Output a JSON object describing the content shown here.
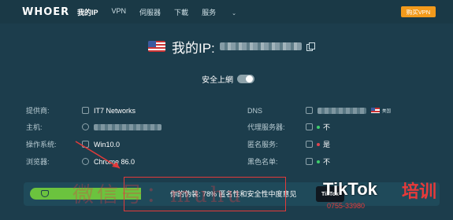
{
  "header": {
    "logo": "WHOER",
    "nav": [
      "我的IP",
      "VPN",
      "伺服器",
      "下載",
      "服务"
    ],
    "nav_active_index": 0,
    "buy_button": "购买VPN"
  },
  "ip": {
    "label": "我的IP:",
    "country_flag": "us-flag"
  },
  "safe_browsing": {
    "label": "安全上網",
    "enabled": false
  },
  "left_info": [
    {
      "label": "提供商:",
      "value": "IT7 Networks",
      "icon": "network-icon"
    },
    {
      "label": "主机:",
      "value": "",
      "icon": "host-icon"
    },
    {
      "label": "操作系统:",
      "value": "Win10.0",
      "icon": "windows-icon"
    },
    {
      "label": "浏览器:",
      "value": "Chrome 86.0",
      "icon": "chrome-icon"
    }
  ],
  "right_info": [
    {
      "label": "DNS",
      "value": "美国",
      "icon": "dns-icon",
      "status": ""
    },
    {
      "label": "代理服务器:",
      "value": "不",
      "icon": "proxy-icon",
      "status": "green"
    },
    {
      "label": "匿名服务:",
      "value": "是",
      "icon": "anonymity-icon",
      "status": "red"
    },
    {
      "label": "黑色名单:",
      "value": "不",
      "icon": "blacklist-icon",
      "status": "green"
    }
  ],
  "score": {
    "text": "你的伪装: 78% 匿名性和安全性中度意见",
    "percent": 78
  },
  "watermark": {
    "cn": "微信号：muhu",
    "tiktok_badge": "TikTok",
    "tiktok": "TikTok",
    "training": "培训",
    "phone": "0755-33980"
  },
  "colors": {
    "background": "#1c3d4c",
    "accent_orange": "#f29a1c",
    "score_green": "#6bc33e",
    "status_green": "#3fce6c",
    "status_red": "#e0444f",
    "annotation_red": "#e23a3a"
  }
}
